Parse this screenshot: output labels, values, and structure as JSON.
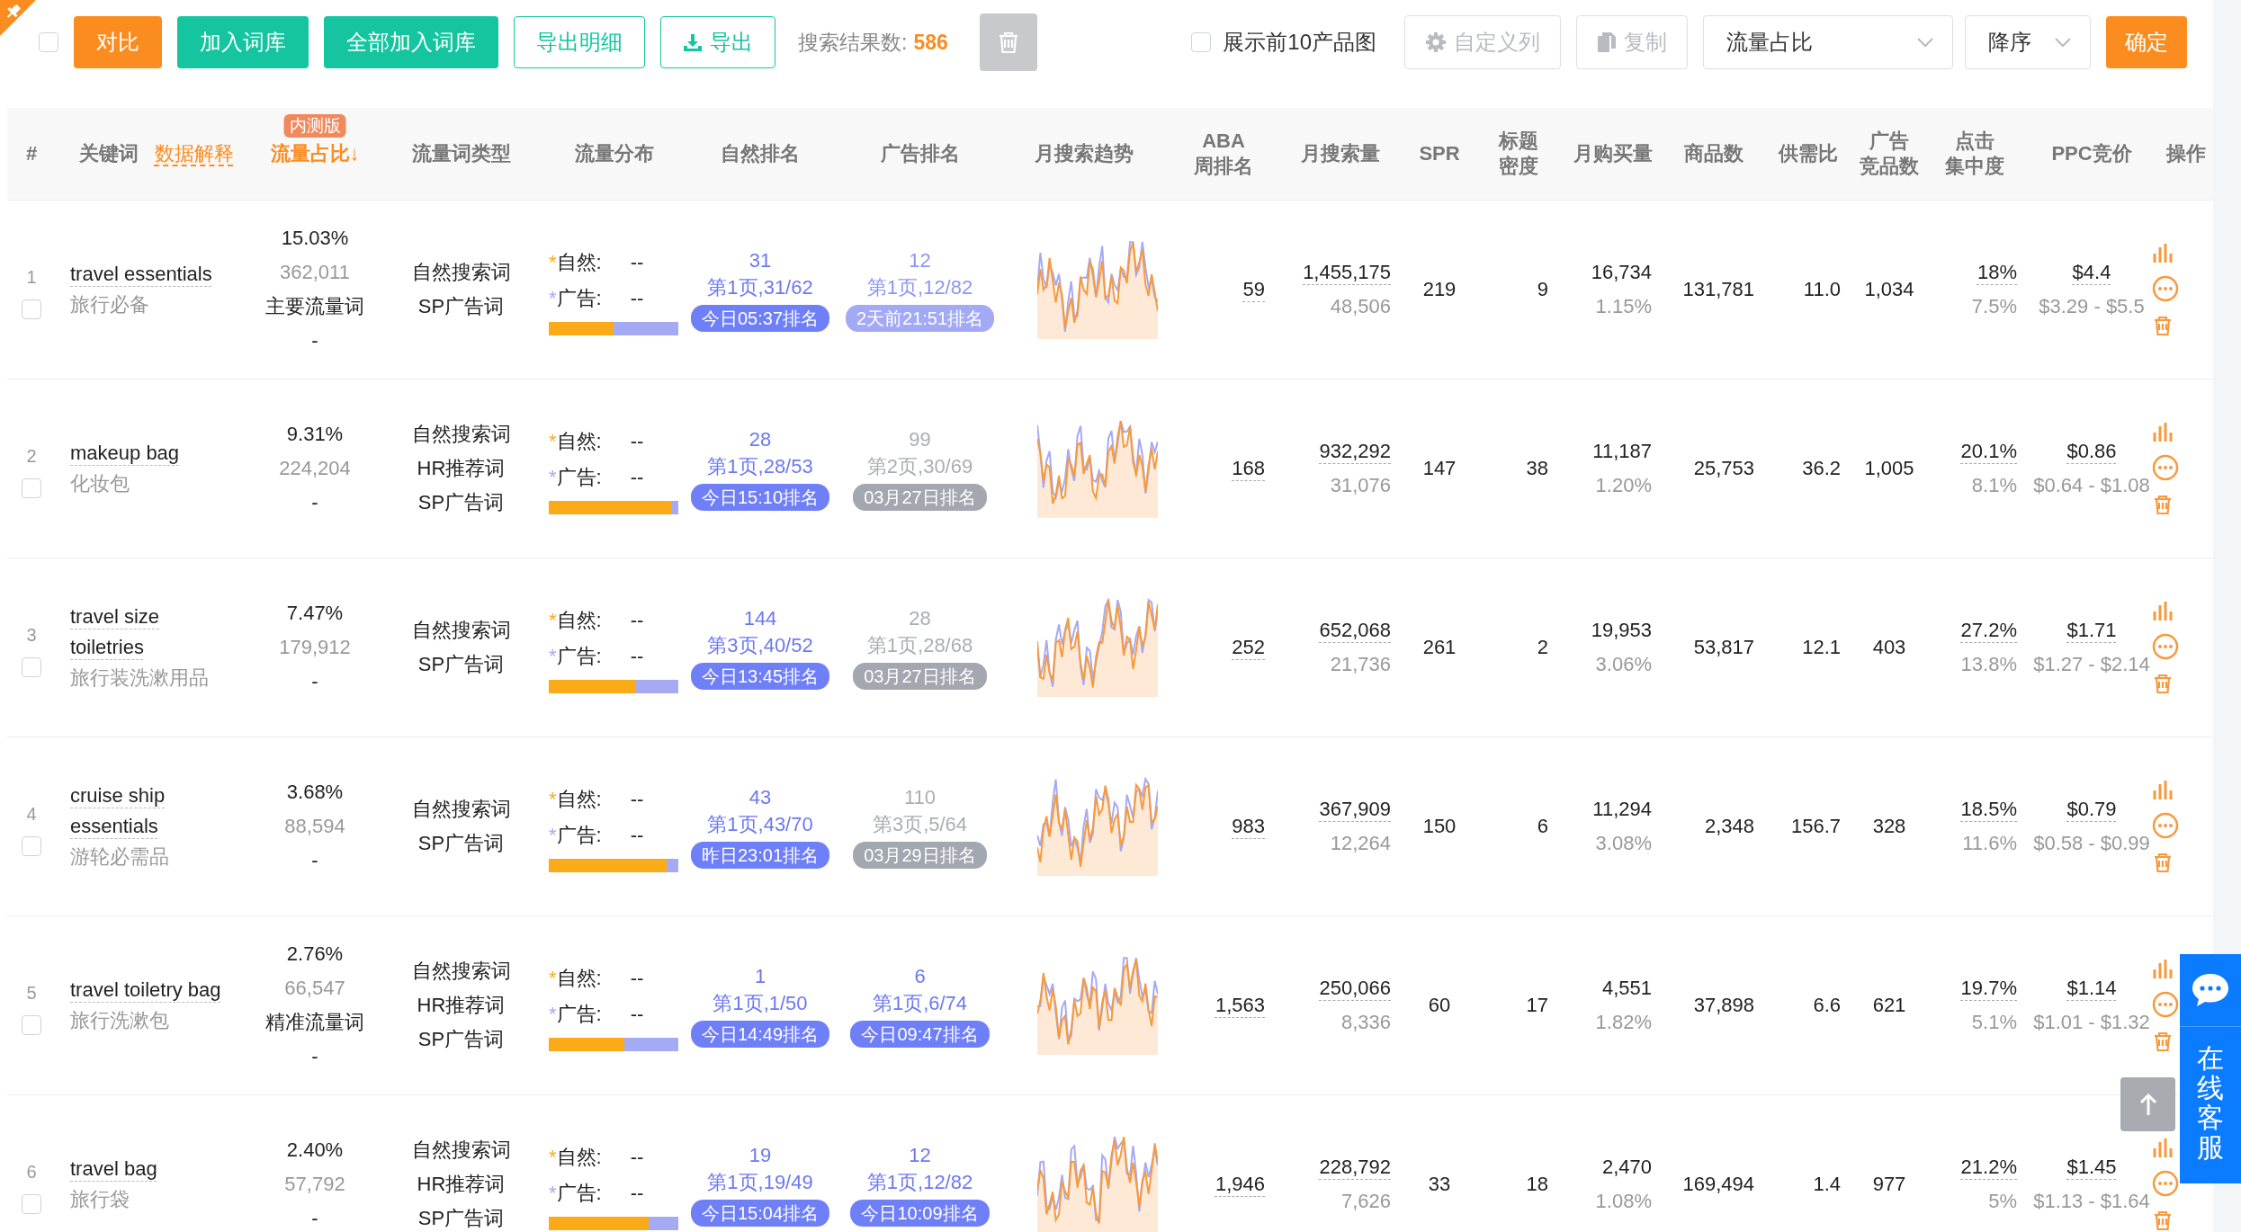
{
  "toolbar": {
    "select_all": {
      "checked": false
    },
    "buttons": [
      {
        "label": "对比",
        "kind": "primary"
      },
      {
        "label": "加入词库",
        "kind": "success"
      },
      {
        "label": "全部加入词库",
        "kind": "success"
      },
      {
        "label": "导出明细",
        "kind": "outline"
      },
      {
        "label": "导出",
        "kind": "export"
      }
    ],
    "result_label": "搜索结果数:",
    "result_count": "586",
    "delete_button": {
      "disabled": true
    },
    "show_images": {
      "label": "展示前10产品图",
      "checked": false
    },
    "tools": [
      {
        "label": "自定义列",
        "kind": "columns",
        "disabled": true
      },
      {
        "label": "复制",
        "kind": "copy",
        "disabled": true
      }
    ],
    "sort_field": {
      "value": "流量占比"
    },
    "sort_order": {
      "value": "降序"
    },
    "confirm": {
      "label": "确定"
    }
  },
  "table": {
    "columns": [
      {
        "label": "#",
        "sorted": false
      },
      {
        "label": "关键词",
        "sorted": false,
        "link": "数据解释"
      },
      {
        "label": "流量占比↓",
        "sorted": true,
        "badge": "内测版"
      },
      {
        "label": "流量词类型",
        "sorted": false
      },
      {
        "label": "流量分布",
        "sorted": false
      },
      {
        "label": "自然排名",
        "sorted": false
      },
      {
        "label": "广告排名",
        "sorted": false
      },
      {
        "label": "月搜索趋势",
        "sorted": false
      },
      {
        "lines": [
          "ABA",
          "周排名"
        ],
        "sorted": false
      },
      {
        "label": "月搜索量",
        "sorted": false
      },
      {
        "label": "SPR",
        "sorted": false
      },
      {
        "lines": [
          "标题",
          "密度"
        ],
        "sorted": false
      },
      {
        "label": "月购买量",
        "sorted": false
      },
      {
        "label": "商品数",
        "sorted": false
      },
      {
        "label": "供需比",
        "sorted": false
      },
      {
        "lines": [
          "广告",
          "竞品数"
        ],
        "sorted": false
      },
      {
        "lines": [
          "点击",
          "集中度"
        ],
        "sorted": false
      },
      {
        "label": "PPC竞价",
        "sorted": false
      },
      {
        "label": "操作",
        "sorted": false
      }
    ],
    "rows": [
      {
        "index": "1",
        "checked": false,
        "keyword": "travel essentials",
        "translation": "旅行必备",
        "share": {
          "percent": "15.03%",
          "count": "362,011",
          "label": "主要流量词",
          "extra": "-"
        },
        "types": [
          "自然搜索词",
          "SP广告词"
        ],
        "flow": {
          "items": [
            {
              "kind": "natural",
              "mark": "*",
              "label": "自然:",
              "value": "--"
            },
            {
              "kind": "ad",
              "mark": "*",
              "label": "广告:",
              "value": "--"
            }
          ],
          "level": 0.5
        },
        "natural_rank": {
          "rank": "31",
          "page": "第1页,31/62",
          "time": "今日05:37排名",
          "kind": "current"
        },
        "ad_rank": {
          "rank": "12",
          "page": "第1页,12/82",
          "time": "2天前21:51排名",
          "kind": "recent"
        },
        "aba_rank": "59",
        "searches": {
          "value": "1,455,175",
          "sub": "48,506"
        },
        "spr": "219",
        "title_density": "9",
        "purchases": {
          "value": "16,734",
          "sub": "1.15%"
        },
        "products": "131,781",
        "supply_ratio": "11.0",
        "ad_competitors": "1,034",
        "click": {
          "value": "18%",
          "sub": "7.5%"
        },
        "ppc": {
          "value": "$4.4",
          "range": "$3.29 - $5.5"
        }
      },
      {
        "index": "2",
        "checked": false,
        "keyword": "makeup bag",
        "translation": "化妆包",
        "share": {
          "percent": "9.31%",
          "count": "224,204",
          "extra": "-"
        },
        "types": [
          "自然搜索词",
          "HR推荐词",
          "SP广告词"
        ],
        "flow": {
          "items": [
            {
              "kind": "natural",
              "mark": "*",
              "label": "自然:",
              "value": "--"
            },
            {
              "kind": "ad",
              "mark": "*",
              "label": "广告:",
              "value": "--"
            }
          ],
          "level": 0.95
        },
        "natural_rank": {
          "rank": "28",
          "page": "第1页,28/53",
          "time": "今日15:10排名",
          "kind": "current"
        },
        "ad_rank": {
          "rank": "99",
          "page": "第2页,30/69",
          "time": "03月27日排名",
          "kind": "stale"
        },
        "aba_rank": "168",
        "searches": {
          "value": "932,292",
          "sub": "31,076"
        },
        "spr": "147",
        "title_density": "38",
        "purchases": {
          "value": "11,187",
          "sub": "1.20%"
        },
        "products": "25,753",
        "supply_ratio": "36.2",
        "ad_competitors": "1,005",
        "click": {
          "value": "20.1%",
          "sub": "8.1%"
        },
        "ppc": {
          "value": "$0.86",
          "range": "$0.64 - $1.08"
        }
      },
      {
        "index": "3",
        "checked": false,
        "keyword": "travel size toiletries",
        "translation": "旅行装洗漱用品",
        "share": {
          "percent": "7.47%",
          "count": "179,912",
          "extra": "-"
        },
        "types": [
          "自然搜索词",
          "SP广告词"
        ],
        "flow": {
          "items": [
            {
              "kind": "natural",
              "mark": "*",
              "label": "自然:",
              "value": "--"
            },
            {
              "kind": "ad",
              "mark": "*",
              "label": "广告:",
              "value": "--"
            }
          ],
          "level": 0.67
        },
        "natural_rank": {
          "rank": "144",
          "page": "第3页,40/52",
          "time": "今日13:45排名",
          "kind": "current"
        },
        "ad_rank": {
          "rank": "28",
          "page": "第1页,28/68",
          "time": "03月27日排名",
          "kind": "stale"
        },
        "aba_rank": "252",
        "searches": {
          "value": "652,068",
          "sub": "21,736"
        },
        "spr": "261",
        "title_density": "2",
        "purchases": {
          "value": "19,953",
          "sub": "3.06%"
        },
        "products": "53,817",
        "supply_ratio": "12.1",
        "ad_competitors": "403",
        "click": {
          "value": "27.2%",
          "sub": "13.8%"
        },
        "ppc": {
          "value": "$1.71",
          "range": "$1.27 - $2.14"
        }
      },
      {
        "index": "4",
        "checked": false,
        "keyword": "cruise ship essentials",
        "translation": "游轮必需品",
        "share": {
          "percent": "3.68%",
          "count": "88,594",
          "extra": "-"
        },
        "types": [
          "自然搜索词",
          "SP广告词"
        ],
        "flow": {
          "items": [
            {
              "kind": "natural",
              "mark": "*",
              "label": "自然:",
              "value": "--"
            },
            {
              "kind": "ad",
              "mark": "*",
              "label": "广告:",
              "value": "--"
            }
          ],
          "level": 0.91
        },
        "natural_rank": {
          "rank": "43",
          "page": "第1页,43/70",
          "time": "昨日23:01排名",
          "kind": "current"
        },
        "ad_rank": {
          "rank": "110",
          "page": "第3页,5/64",
          "time": "03月29日排名",
          "kind": "stale"
        },
        "aba_rank": "983",
        "searches": {
          "value": "367,909",
          "sub": "12,264"
        },
        "spr": "150",
        "title_density": "6",
        "purchases": {
          "value": "11,294",
          "sub": "3.08%"
        },
        "products": "2,348",
        "supply_ratio": "156.7",
        "ad_competitors": "328",
        "click": {
          "value": "18.5%",
          "sub": "11.6%"
        },
        "ppc": {
          "value": "$0.79",
          "range": "$0.58 - $0.99"
        }
      },
      {
        "index": "5",
        "checked": false,
        "keyword": "travel toiletry bag",
        "translation": "旅行洗漱包",
        "share": {
          "percent": "2.76%",
          "count": "66,547",
          "label": "精准流量词",
          "extra": "-"
        },
        "types": [
          "自然搜索词",
          "HR推荐词",
          "SP广告词"
        ],
        "flow": {
          "items": [
            {
              "kind": "natural",
              "mark": "*",
              "label": "自然:",
              "value": "--"
            },
            {
              "kind": "ad",
              "mark": "*",
              "label": "广告:",
              "value": "--"
            }
          ],
          "level": 0.58
        },
        "natural_rank": {
          "rank": "1",
          "page": "第1页,1/50",
          "time": "今日14:49排名",
          "kind": "current"
        },
        "ad_rank": {
          "rank": "6",
          "page": "第1页,6/74",
          "time": "今日09:47排名",
          "kind": "current"
        },
        "aba_rank": "1,563",
        "searches": {
          "value": "250,066",
          "sub": "8,336"
        },
        "spr": "60",
        "title_density": "17",
        "purchases": {
          "value": "4,551",
          "sub": "1.82%"
        },
        "products": "37,898",
        "supply_ratio": "6.6",
        "ad_competitors": "621",
        "click": {
          "value": "19.7%",
          "sub": "5.1%"
        },
        "ppc": {
          "value": "$1.14",
          "range": "$1.01 - $1.32"
        }
      },
      {
        "index": "6",
        "checked": false,
        "keyword": "travel bag",
        "translation": "旅行袋",
        "share": {
          "percent": "2.40%",
          "count": "57,792",
          "extra": "-"
        },
        "types": [
          "自然搜索词",
          "HR推荐词",
          "SP广告词"
        ],
        "flow": {
          "items": [
            {
              "kind": "natural",
              "mark": "*",
              "label": "自然:",
              "value": "--"
            },
            {
              "kind": "ad",
              "mark": "*",
              "label": "广告:",
              "value": "--"
            }
          ],
          "level": 0.77
        },
        "natural_rank": {
          "rank": "19",
          "page": "第1页,19/49",
          "time": "今日15:04排名",
          "kind": "current"
        },
        "ad_rank": {
          "rank": "12",
          "page": "第1页,12/82",
          "time": "今日10:09排名",
          "kind": "current"
        },
        "aba_rank": "1,946",
        "searches": {
          "value": "228,792",
          "sub": "7,626"
        },
        "spr": "33",
        "title_density": "18",
        "purchases": {
          "value": "2,470",
          "sub": "1.08%"
        },
        "products": "169,494",
        "supply_ratio": "1.4",
        "ad_competitors": "977",
        "click": {
          "value": "21.2%",
          "sub": "5%"
        },
        "ppc": {
          "value": "$1.45",
          "range": "$1.13 - $1.64"
        }
      }
    ]
  },
  "support_widget": {
    "label": "在线客服"
  }
}
